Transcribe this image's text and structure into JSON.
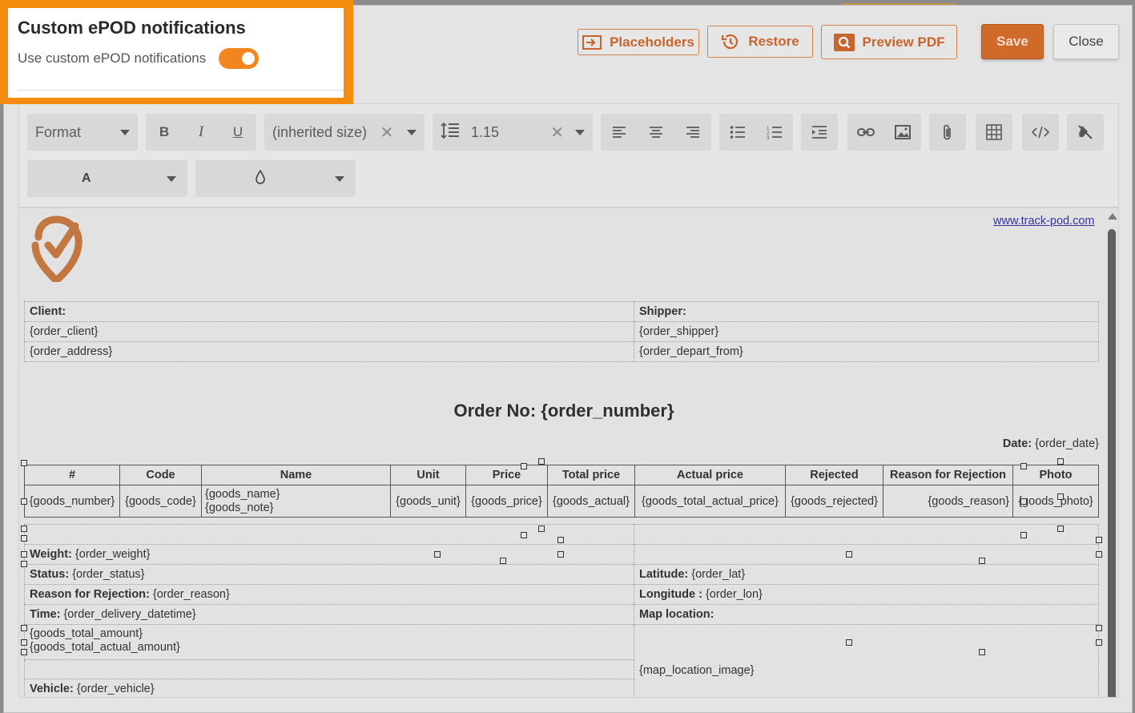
{
  "overlay": {
    "title": "Custom ePOD notifications",
    "toggle_label": "Use custom ePOD notifications",
    "toggle_on": true
  },
  "actions": {
    "placeholders": "Placeholders",
    "restore": "Restore",
    "preview_pdf": "Preview PDF",
    "save": "Save",
    "close": "Close"
  },
  "toolbar": {
    "format": "Format",
    "font_size": "(inherited size)",
    "line_height": "1.15",
    "font_color_glyph": "A"
  },
  "document": {
    "site_link": "www.track-pod.com",
    "client_label": "Client:",
    "shipper_label": "Shipper:",
    "order_client": "{order_client}",
    "order_shipper": "{order_shipper}",
    "order_address": "{order_address}",
    "order_depart_from": "{order_depart_from}",
    "order_title": "Order No: {order_number}",
    "date_label": "Date:",
    "date_value": "{order_date}",
    "goods_headers": [
      "#",
      "Code",
      "Name",
      "Unit",
      "Price",
      "Total price",
      "Actual price",
      "Rejected",
      "Reason for Rejection",
      "Photo"
    ],
    "goods_row": [
      "{goods_number}",
      "{goods_code}",
      "{goods_name}",
      "{goods_unit}",
      "{goods_price}",
      "{goods_actual}",
      "{goods_total_actual_price}",
      "{goods_rejected}",
      "{goods_reason}",
      "{goods_photo}"
    ],
    "goods_note": "{goods_note}",
    "weight_label": "Weight:",
    "weight_value": "{order_weight}",
    "status_label": "Status:",
    "status_value": "{order_status}",
    "latitude_label": "Latitude:",
    "latitude_value": "{order_lat}",
    "reason_label": "Reason for Rejection:",
    "reason_value": "{order_reason}",
    "longitude_label": "Longitude :",
    "longitude_value": "{order_lon}",
    "time_label": "Time:",
    "time_value": "{order_delivery_datetime}",
    "map_label": "Map location:",
    "total_amount": "{goods_total_amount}",
    "total_actual_amount": "{goods_total_actual_amount}",
    "map_image": "{map_location_image}",
    "vehicle_label": "Vehicle:",
    "vehicle_value": "{order_vehicle}"
  },
  "colors": {
    "accent": "#f48c10",
    "button_text": "#c8652c",
    "save_bg": "#cf6a2a"
  }
}
